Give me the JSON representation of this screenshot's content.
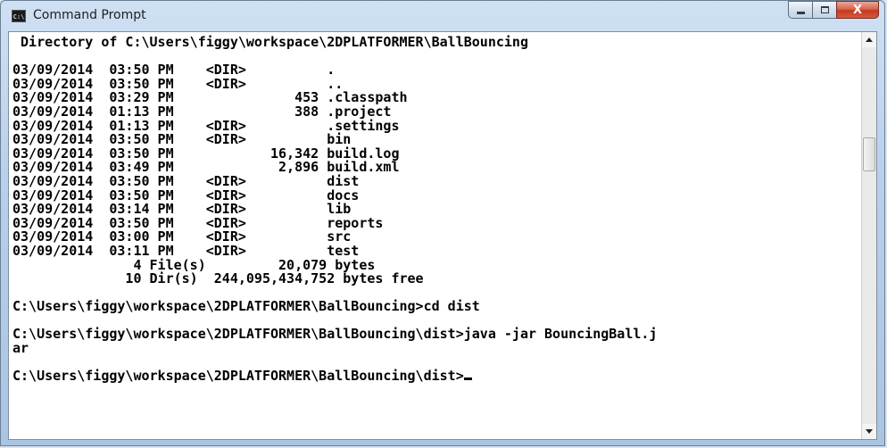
{
  "window": {
    "title": "Command Prompt",
    "icon": "cmd-icon",
    "icon_text": "C:\\",
    "buttons": {
      "minimize": "minimize-icon",
      "maximize": "maximize-icon",
      "close": "close-icon",
      "close_glyph": "X"
    }
  },
  "console": {
    "lines": [
      " Directory of C:\\Users\\figgy\\workspace\\2DPLATFORMER\\BallBouncing",
      "",
      "03/09/2014  03:50 PM    <DIR>          .",
      "03/09/2014  03:50 PM    <DIR>          ..",
      "03/09/2014  03:29 PM               453 .classpath",
      "03/09/2014  01:13 PM               388 .project",
      "03/09/2014  01:13 PM    <DIR>          .settings",
      "03/09/2014  03:50 PM    <DIR>          bin",
      "03/09/2014  03:50 PM            16,342 build.log",
      "03/09/2014  03:49 PM             2,896 build.xml",
      "03/09/2014  03:50 PM    <DIR>          dist",
      "03/09/2014  03:50 PM    <DIR>          docs",
      "03/09/2014  03:14 PM    <DIR>          lib",
      "03/09/2014  03:50 PM    <DIR>          reports",
      "03/09/2014  03:00 PM    <DIR>          src",
      "03/09/2014  03:11 PM    <DIR>          test",
      "               4 File(s)         20,079 bytes",
      "              10 Dir(s)  244,095,434,752 bytes free",
      "",
      "C:\\Users\\figgy\\workspace\\2DPLATFORMER\\BallBouncing>cd dist",
      "",
      "C:\\Users\\figgy\\workspace\\2DPLATFORMER\\BallBouncing\\dist>java -jar BouncingBall.j",
      "ar",
      ""
    ],
    "prompt": "C:\\Users\\figgy\\workspace\\2DPLATFORMER\\BallBouncing\\dist>"
  },
  "colors": {
    "console_bg": "#ffffff",
    "console_text": "#000000",
    "close_button": "#c4391f",
    "titlebar": "#b9d0ea"
  }
}
